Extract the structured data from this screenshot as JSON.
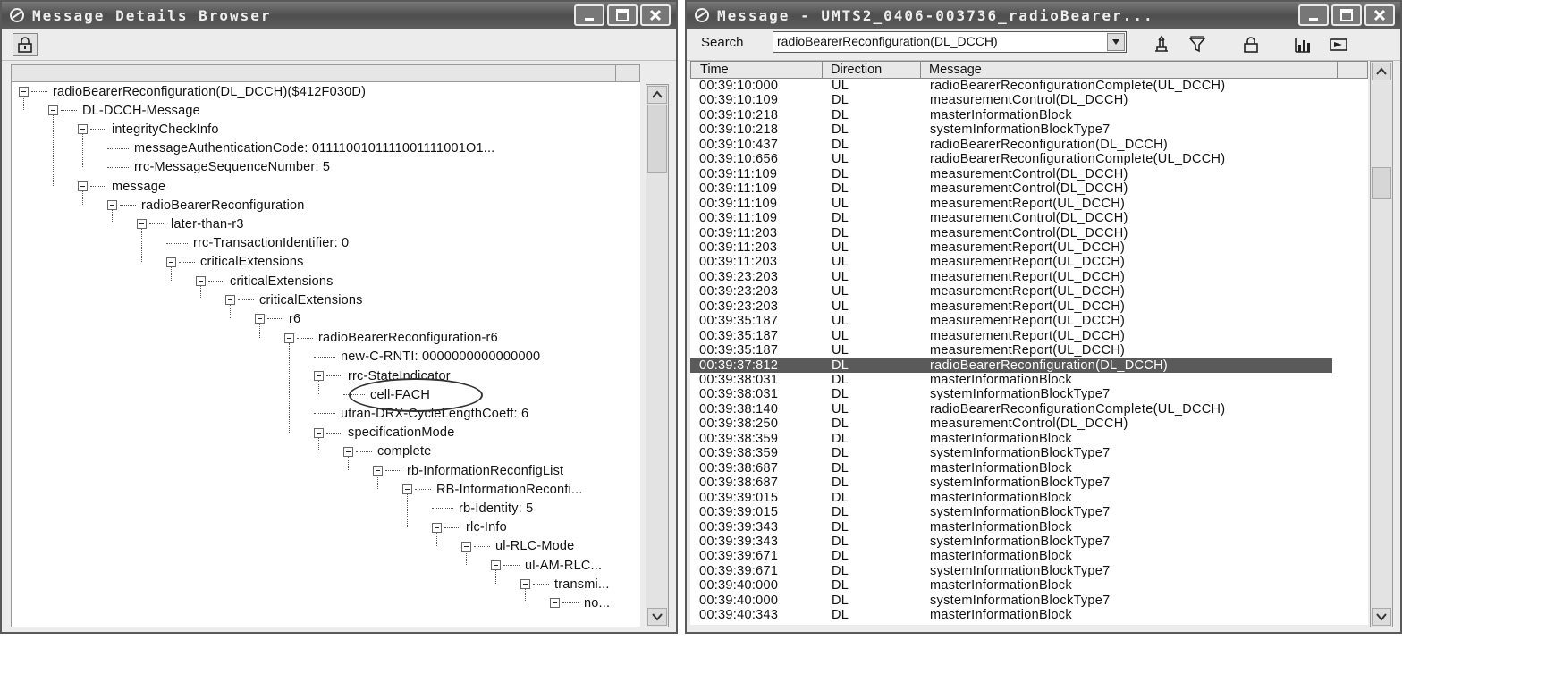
{
  "left": {
    "title": "Message Details Browser",
    "tree": [
      {
        "text": "radioBearerReconfiguration(DL_DCCH)($412F030D)",
        "depth": 0,
        "expander": true
      },
      {
        "text": "DL-DCCH-Message",
        "depth": 1,
        "expander": true
      },
      {
        "text": "integrityCheckInfo",
        "depth": 2,
        "expander": true
      },
      {
        "text": "messageAuthenticationCode: 0111100101111001111001O1...",
        "depth": 3,
        "expander": false
      },
      {
        "text": "rrc-MessageSequenceNumber: 5",
        "depth": 3,
        "expander": false
      },
      {
        "text": "message",
        "depth": 2,
        "expander": true
      },
      {
        "text": "radioBearerReconfiguration",
        "depth": 3,
        "expander": true
      },
      {
        "text": "later-than-r3",
        "depth": 4,
        "expander": true
      },
      {
        "text": "rrc-TransactionIdentifier: 0",
        "depth": 5,
        "expander": false
      },
      {
        "text": "criticalExtensions",
        "depth": 5,
        "expander": true
      },
      {
        "text": "criticalExtensions",
        "depth": 6,
        "expander": true
      },
      {
        "text": "criticalExtensions",
        "depth": 7,
        "expander": true
      },
      {
        "text": "r6",
        "depth": 8,
        "expander": true
      },
      {
        "text": "radioBearerReconfiguration-r6",
        "depth": 9,
        "expander": true
      },
      {
        "text": "new-C-RNTI: 0000000000000000",
        "depth": 10,
        "expander": false
      },
      {
        "text": "rrc-StateIndicator",
        "depth": 10,
        "expander": true
      },
      {
        "text": "cell-FACH",
        "depth": 11,
        "expander": false
      },
      {
        "text": "utran-DRX-CycleLengthCoeff: 6",
        "depth": 10,
        "expander": false
      },
      {
        "text": "specificationMode",
        "depth": 10,
        "expander": true
      },
      {
        "text": "complete",
        "depth": 11,
        "expander": true
      },
      {
        "text": "rb-InformationReconfigList",
        "depth": 12,
        "expander": true
      },
      {
        "text": "RB-InformationReconfi...",
        "depth": 13,
        "expander": true
      },
      {
        "text": "rb-Identity: 5",
        "depth": 14,
        "expander": false
      },
      {
        "text": "rlc-Info",
        "depth": 14,
        "expander": true
      },
      {
        "text": "ul-RLC-Mode",
        "depth": 15,
        "expander": true
      },
      {
        "text": "ul-AM-RLC...",
        "depth": 16,
        "expander": true
      },
      {
        "text": "transmi...",
        "depth": 17,
        "expander": true
      },
      {
        "text": "no...",
        "depth": 18,
        "expander": true
      }
    ]
  },
  "right": {
    "title": "Message - UMTS2_0406-003736_radioBearer...",
    "search_label": "Search",
    "search_value": "radioBearerReconfiguration(DL_DCCH)",
    "columns": [
      "Time",
      "Direction",
      "Message"
    ],
    "selected_index": 19,
    "rows": [
      [
        "00:39:10:000",
        "UL",
        "radioBearerReconfigurationComplete(UL_DCCH)"
      ],
      [
        "00:39:10:109",
        "DL",
        "measurementControl(DL_DCCH)"
      ],
      [
        "00:39:10:218",
        "DL",
        "masterInformationBlock"
      ],
      [
        "00:39:10:218",
        "DL",
        "systemInformationBlockType7"
      ],
      [
        "00:39:10:437",
        "DL",
        "radioBearerReconfiguration(DL_DCCH)"
      ],
      [
        "00:39:10:656",
        "UL",
        "radioBearerReconfigurationComplete(UL_DCCH)"
      ],
      [
        "00:39:11:109",
        "DL",
        "measurementControl(DL_DCCH)"
      ],
      [
        "00:39:11:109",
        "DL",
        "measurementControl(DL_DCCH)"
      ],
      [
        "00:39:11:109",
        "UL",
        "measurementReport(UL_DCCH)"
      ],
      [
        "00:39:11:109",
        "DL",
        "measurementControl(DL_DCCH)"
      ],
      [
        "00:39:11:203",
        "DL",
        "measurementControl(DL_DCCH)"
      ],
      [
        "00:39:11:203",
        "UL",
        "measurementReport(UL_DCCH)"
      ],
      [
        "00:39:11:203",
        "UL",
        "measurementReport(UL_DCCH)"
      ],
      [
        "00:39:23:203",
        "UL",
        "measurementReport(UL_DCCH)"
      ],
      [
        "00:39:23:203",
        "UL",
        "measurementReport(UL_DCCH)"
      ],
      [
        "00:39:23:203",
        "UL",
        "measurementReport(UL_DCCH)"
      ],
      [
        "00:39:35:187",
        "UL",
        "measurementReport(UL_DCCH)"
      ],
      [
        "00:39:35:187",
        "UL",
        "measurementReport(UL_DCCH)"
      ],
      [
        "00:39:35:187",
        "UL",
        "measurementReport(UL_DCCH)"
      ],
      [
        "00:39:37:812",
        "DL",
        "radioBearerReconfiguration(DL_DCCH)"
      ],
      [
        "00:39:38:031",
        "DL",
        "masterInformationBlock"
      ],
      [
        "00:39:38:031",
        "DL",
        "systemInformationBlockType7"
      ],
      [
        "00:39:38:140",
        "UL",
        "radioBearerReconfigurationComplete(UL_DCCH)"
      ],
      [
        "00:39:38:250",
        "DL",
        "measurementControl(DL_DCCH)"
      ],
      [
        "00:39:38:359",
        "DL",
        "masterInformationBlock"
      ],
      [
        "00:39:38:359",
        "DL",
        "systemInformationBlockType7"
      ],
      [
        "00:39:38:687",
        "DL",
        "masterInformationBlock"
      ],
      [
        "00:39:38:687",
        "DL",
        "systemInformationBlockType7"
      ],
      [
        "00:39:39:015",
        "DL",
        "masterInformationBlock"
      ],
      [
        "00:39:39:015",
        "DL",
        "systemInformationBlockType7"
      ],
      [
        "00:39:39:343",
        "DL",
        "masterInformationBlock"
      ],
      [
        "00:39:39:343",
        "DL",
        "systemInformationBlockType7"
      ],
      [
        "00:39:39:671",
        "DL",
        "masterInformationBlock"
      ],
      [
        "00:39:39:671",
        "DL",
        "systemInformationBlockType7"
      ],
      [
        "00:39:40:000",
        "DL",
        "masterInformationBlock"
      ],
      [
        "00:39:40:000",
        "DL",
        "systemInformationBlockType7"
      ],
      [
        "00:39:40:343",
        "DL",
        "masterInformationBlock"
      ]
    ]
  },
  "icons": {
    "title_icon": "app-icon",
    "left_toolbar": [
      "lock-icon"
    ],
    "right_toolbar": [
      "filter-icon",
      "filter-clear-icon",
      "lock-icon",
      "chart-icon",
      "next-icon"
    ]
  }
}
